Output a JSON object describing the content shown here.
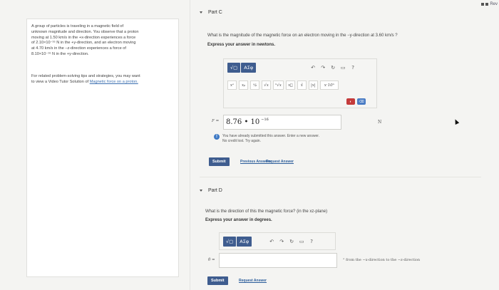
{
  "top_badge": {
    "text": "Rev"
  },
  "problem": {
    "lines": [
      "A group of particles is traveling in a magnetic field of",
      "unknown magnitude and direction. You observe that a proton",
      "moving at 1.50 km/s in the +x-direction experiences a force",
      "of 2.10×10⁻¹⁶ N in the +y-direction, and an electron moving",
      "at 4.70 km/s in the −z-direction experiences a force of",
      "8.10×10⁻¹⁶ N in the +y-direction."
    ],
    "tips_lines": [
      "For related problem-solving tips and strategies, you may want",
      "to view a Video Tutor Solution of "
    ],
    "tips_link": "Magnetic force on a proton."
  },
  "part_c": {
    "title": "Part C",
    "question": "What is the magnitude of the magnetic force on an electron moving in the −y-direction at 3.60 km/s ?",
    "instruction": "Express your answer in newtons.",
    "toolbar": {
      "btn1": "√▢",
      "btn2": "ΑΣφ",
      "icons": [
        "↶",
        "↷",
        "↻",
        "▭",
        "?"
      ],
      "math": [
        "xᵃ",
        "xᵦ",
        "ᵃ⁄ᵦ",
        "√x",
        "ⁿ√x",
        "x⃗",
        "x̂",
        "|x|",
        "x·10ⁿ"
      ],
      "small_btns": [
        "◐",
        "⌫"
      ]
    },
    "var": "F =",
    "answer_mantissa": "8.76 • 10",
    "answer_exp": "−16",
    "unit": "N",
    "feedback_line1": "You have already submitted this answer. Enter a new answer.",
    "feedback_line2": "No credit lost. Try again.",
    "submit": "Submit",
    "link1": "Previous Answers",
    "link2": "Request Answer"
  },
  "part_d": {
    "title": "Part D",
    "question": "What is the direction of this the magnetic force? (in the xz-plane)",
    "instruction": "Express your answer in degrees.",
    "toolbar": {
      "btn1": "√▢",
      "btn2": "ΑΣφ",
      "icons": [
        "↶",
        "↷",
        "↻",
        "▭",
        "?"
      ]
    },
    "var": "θ =",
    "unit": "° from the −x-direction to the −z-direction",
    "submit": "Submit",
    "link1": "Request Answer"
  }
}
